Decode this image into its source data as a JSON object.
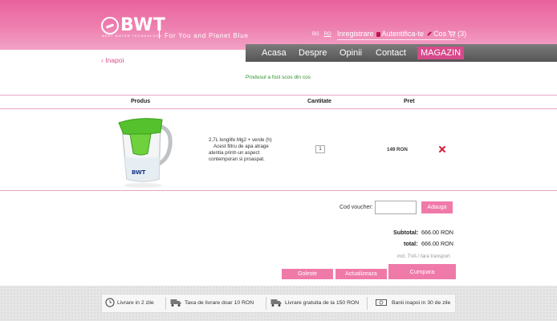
{
  "header": {
    "brand": "BWT",
    "brand_sub": "BEST WATER TECHNOLOGY",
    "slogan": "For You and Planet Blue",
    "languages": [
      "BG",
      "RO"
    ],
    "active_language": "RO",
    "links": {
      "register": "Inregistrare",
      "login": "Autentifica-te",
      "cart": "Cos",
      "cart_count": "(3)"
    }
  },
  "nav": {
    "items": [
      "Acasa",
      "Despre",
      "Opinii",
      "Contact",
      "MAGAZIN"
    ],
    "active": "MAGAZIN"
  },
  "back_link": "‹ Inapoi",
  "message": "Produsul a fost scos din cos",
  "table": {
    "headers": [
      "Produs",
      "Cantitate",
      "Pret"
    ],
    "rows": [
      {
        "description_line1": "2,7L longlife Mg2 + verde (h)",
        "description_line2": "Acest filtru de apa atrage",
        "description_line3": "atentia printr-un aspect",
        "description_line4": "contemporan si proaspat.",
        "quantity": "1",
        "price": "149 RON",
        "product_label": "BWT"
      }
    ]
  },
  "voucher": {
    "label": "Cod voucher:",
    "value": "",
    "apply_label": "Adauga"
  },
  "summary": {
    "subtotal_label": "Subtotal:",
    "subtotal_value": "666.00 RON",
    "total_label": "total:",
    "total_value": "666.00 RON",
    "note": "incl. TVA / fara transport"
  },
  "actions": {
    "empty": "Goleste",
    "update": "Actualizeaza",
    "buy": "Cumpara"
  },
  "footer": {
    "items": [
      {
        "icon": "clock-icon",
        "text": "Livrare in 2 zile"
      },
      {
        "icon": "truck-icon",
        "text": "Taxa de livrare doar 10 RON"
      },
      {
        "icon": "truck-icon",
        "text": "Livrare gratuita de la 150 RON"
      },
      {
        "icon": "money-icon",
        "text": "Banii inapoi in 30 de zile"
      }
    ]
  },
  "colors": {
    "accent": "#ef7aa9",
    "header_pink": "#e9629d",
    "nav_gray": "#5f5f5f",
    "success_green": "#2f8f2f"
  }
}
